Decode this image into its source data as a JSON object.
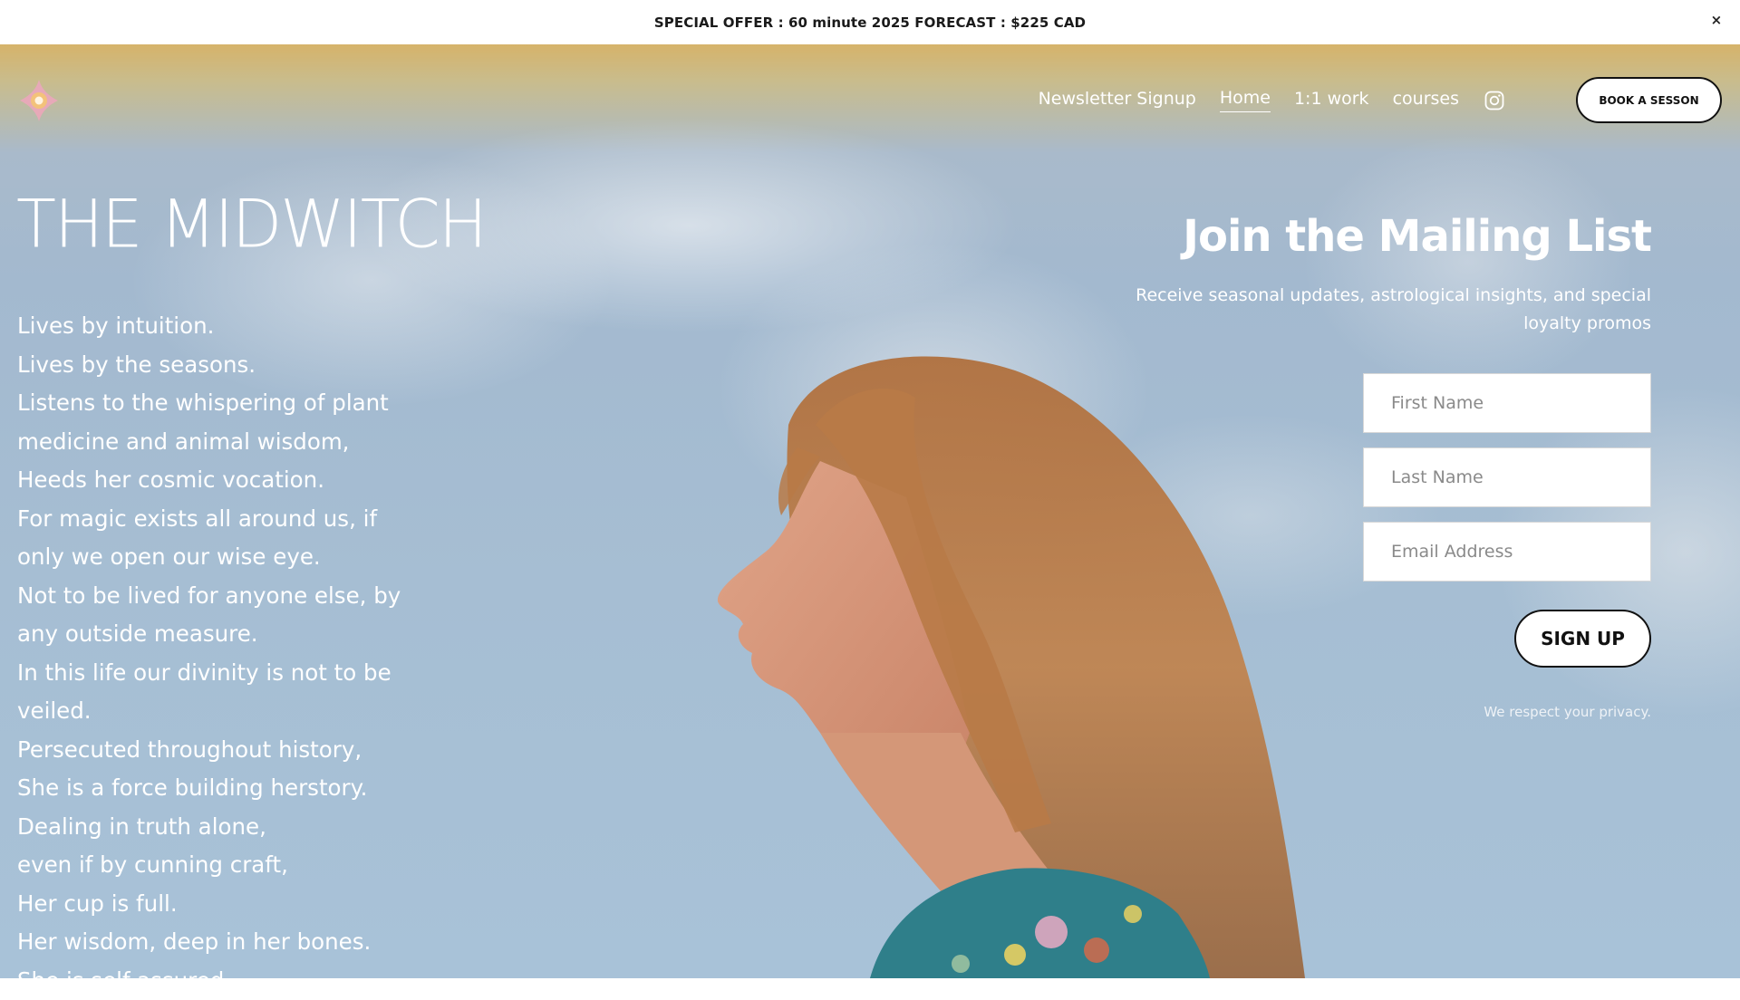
{
  "announcement": {
    "text": "SPECIAL OFFER : 60 minute 2025 FORECAST : $225 CAD",
    "close_symbol": "×"
  },
  "logo": {
    "icon": "compass-star-logo",
    "colors": [
      "#e7a9b8",
      "#f3c27a"
    ]
  },
  "nav": {
    "links": [
      "Newsletter Signup",
      "Home",
      "1:1 work",
      "courses"
    ],
    "active": "Home",
    "social_icon": "instagram-icon",
    "book_button": "BOOK A SESSON"
  },
  "brand": {
    "title": "THE MIDWITCH"
  },
  "poem": {
    "lines": [
      "Lives by intuition.",
      "Lives by the seasons.",
      "Listens to the whispering of plant",
      "medicine and animal wisdom,",
      "Heeds her cosmic vocation.",
      "For magic exists all around us, if",
      "only we open our wise eye.",
      "Not to be lived for anyone else, by",
      "any outside measure.",
      "In this life our divinity is not to be",
      "veiled.",
      "Persecuted throughout history,",
      "She is a force building herstory.",
      "Dealing in truth alone,",
      "even if by cunning craft,",
      "Her cup is full.",
      "Her wisdom, deep in her bones.",
      "She is self-assured."
    ]
  },
  "newsletter": {
    "title": "Join the Mailing List",
    "subtitle": "Receive seasonal updates, astrological insights, and special loyalty promos",
    "first_name_placeholder": "First Name",
    "last_name_placeholder": "Last Name",
    "email_placeholder": "Email Address",
    "submit_label": "SIGN UP",
    "privacy_note": "We respect your privacy."
  },
  "colors": {
    "sky": "#a6bed3",
    "sky_top_glow": "#d6b36a",
    "button_border": "#111111"
  }
}
